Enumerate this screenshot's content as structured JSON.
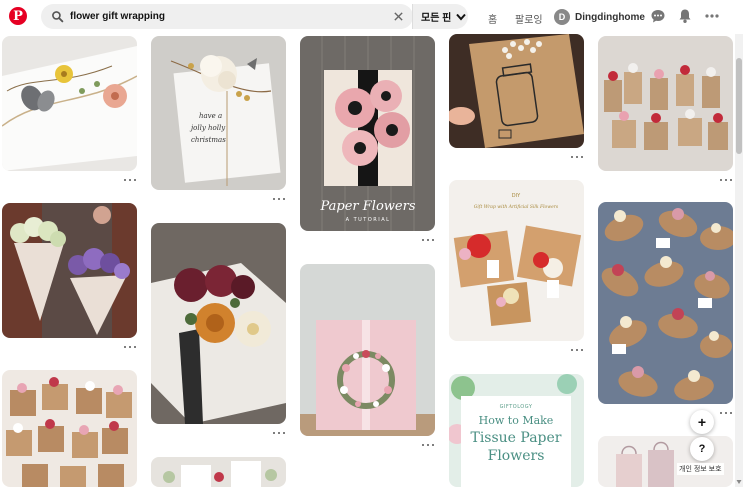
{
  "app": {
    "logo_letter": "P",
    "brand_color": "#e60023"
  },
  "search": {
    "query": "flower gift wrapping",
    "placeholder": ""
  },
  "filter": {
    "label": "모든 핀"
  },
  "nav": {
    "home": "홈",
    "following": "팔로잉"
  },
  "user": {
    "initial": "D",
    "name": "Dingdinghome"
  },
  "header_icons": [
    "chat-icon",
    "bell-icon",
    "more-icon"
  ],
  "pins": [
    {
      "name": "pin-butterfly-wrap",
      "caption": ""
    },
    {
      "name": "pin-white-rose-wrap",
      "caption": ""
    },
    {
      "name": "pin-paper-flowers",
      "caption": "Paper Flowers",
      "subcaption": "A TUTORIAL"
    },
    {
      "name": "pin-mason-jar-kraft",
      "caption": ""
    },
    {
      "name": "pin-mini-boxes",
      "caption": ""
    },
    {
      "name": "pin-flower-cones",
      "caption": ""
    },
    {
      "name": "pin-rose-white-box",
      "caption": ""
    },
    {
      "name": "pin-silk-flowers",
      "caption": "Gift Wrap with Artificial Silk Flowers",
      "label": "DIY"
    },
    {
      "name": "pin-pillow-boxes",
      "caption": ""
    },
    {
      "name": "pin-small-boxes",
      "caption": ""
    },
    {
      "name": "pin-pink-wreath-box",
      "caption": ""
    },
    {
      "name": "pin-tissue-paper",
      "brand": "GIFTOLOGY",
      "caption_line1": "How to Make",
      "caption_line2": "Tissue Paper",
      "caption_line3": "Flowers"
    },
    {
      "name": "pin-tags-bottom",
      "caption": ""
    },
    {
      "name": "pin-shopping-bags",
      "caption": ""
    }
  ],
  "fab": {
    "add": "+",
    "help": "?"
  },
  "privacy_label": "개인 정보 보호"
}
